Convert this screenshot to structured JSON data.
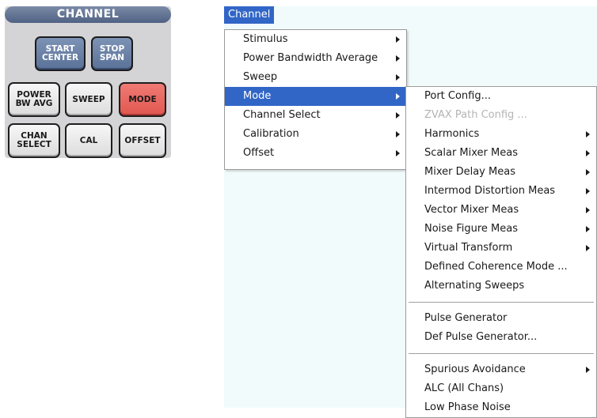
{
  "panel": {
    "title": "CHANNEL",
    "keys": [
      {
        "label": "START\nCENTER"
      },
      {
        "label": "STOP\nSPAN"
      },
      {
        "label": "POWER\nBW AVG"
      },
      {
        "label": "SWEEP"
      },
      {
        "label": "MODE"
      },
      {
        "label": "CHAN\nSELECT"
      },
      {
        "label": "CAL"
      },
      {
        "label": "OFFSET"
      }
    ]
  },
  "menubar": {
    "channel": "Channel"
  },
  "channel_menu": {
    "items": [
      {
        "label": "Stimulus",
        "has_submenu": true
      },
      {
        "label": "Power Bandwidth Average",
        "has_submenu": true
      },
      {
        "label": "Sweep",
        "has_submenu": true
      },
      {
        "label": "Mode",
        "has_submenu": true,
        "highlighted": true
      },
      {
        "label": "Channel Select",
        "has_submenu": true
      },
      {
        "label": "Calibration",
        "has_submenu": true
      },
      {
        "label": "Offset",
        "has_submenu": true
      }
    ]
  },
  "mode_menu": {
    "items": [
      {
        "label": "Port Config...",
        "has_submenu": false
      },
      {
        "label": "ZVAX Path Config ...",
        "has_submenu": false,
        "disabled": true
      },
      {
        "label": "Harmonics",
        "has_submenu": true
      },
      {
        "label": "Scalar Mixer Meas",
        "has_submenu": true
      },
      {
        "label": "Mixer Delay Meas",
        "has_submenu": true
      },
      {
        "label": "Intermod Distortion Meas",
        "has_submenu": true
      },
      {
        "label": "Vector Mixer Meas",
        "has_submenu": true
      },
      {
        "label": "Noise Figure Meas",
        "has_submenu": true
      },
      {
        "label": "Virtual Transform",
        "has_submenu": true
      },
      {
        "label": "Defined Coherence Mode ...",
        "has_submenu": false
      },
      {
        "label": "Alternating Sweeps",
        "has_submenu": false
      },
      {
        "label": "Pulse Generator",
        "has_submenu": false
      },
      {
        "label": "Def Pulse Generator...",
        "has_submenu": false
      },
      {
        "label": "Spurious Avoidance",
        "has_submenu": true
      },
      {
        "label": "ALC (All Chans)",
        "has_submenu": false
      },
      {
        "label": "Low Phase Noise",
        "has_submenu": false
      }
    ]
  },
  "colors": {
    "highlight": "#3166c7",
    "app_background": "#f1fbfb",
    "mode_key": "#e05850",
    "blue_keys": "#5a7198"
  }
}
